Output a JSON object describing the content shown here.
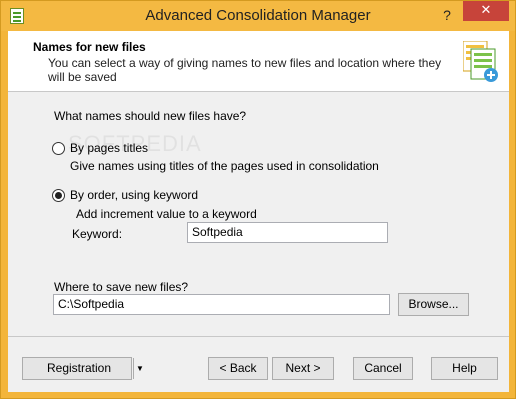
{
  "window": {
    "title": "Advanced Consolidation Manager",
    "help_glyph": "?",
    "close_glyph": "✕"
  },
  "header": {
    "title": "Names for new files",
    "description": "You can select a way of giving names to new files and location where they will be saved"
  },
  "naming": {
    "question": "What names should new files have?",
    "option_pages": {
      "label": "By pages titles",
      "description": "Give names using titles of the pages used in consolidation",
      "checked": false
    },
    "option_order": {
      "label": "By order, using keyword",
      "description": "Add increment value to a keyword",
      "checked": true
    },
    "keyword_label": "Keyword:",
    "keyword_value": "Softpedia"
  },
  "location": {
    "question": "Where to save new files?",
    "path_value": "C:\\Softpedia",
    "browse_label": "Browse..."
  },
  "footer": {
    "registration_label": "Registration",
    "back_label": "< Back",
    "next_label": "Next >",
    "cancel_label": "Cancel",
    "help_label": "Help"
  },
  "watermark": "SOFTPEDIA",
  "colors": {
    "titlebar": "#f4b942",
    "close": "#c7443a"
  }
}
